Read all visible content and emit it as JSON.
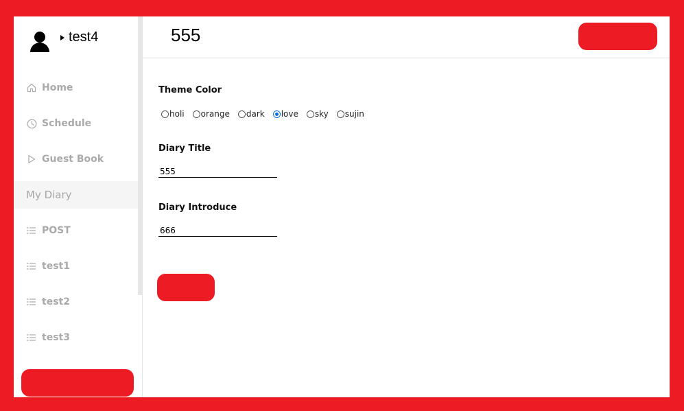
{
  "profile": {
    "username": "test4"
  },
  "sidebar": {
    "items": [
      {
        "label": "Home",
        "icon": "home-icon"
      },
      {
        "label": "Schedule",
        "icon": "clock-icon"
      },
      {
        "label": "Guest Book",
        "icon": "play-icon"
      },
      {
        "label": "My Diary",
        "icon": null
      },
      {
        "label": "POST",
        "icon": "list-icon"
      },
      {
        "label": "test1",
        "icon": "list-icon"
      },
      {
        "label": "test2",
        "icon": "list-icon"
      },
      {
        "label": "test3",
        "icon": "list-icon"
      }
    ]
  },
  "header": {
    "title": "555"
  },
  "form": {
    "theme_label": "Theme Color",
    "themes": [
      "holi",
      "orange",
      "dark",
      "love",
      "sky",
      "sujin"
    ],
    "selected_theme": "love",
    "title_label": "Diary Title",
    "title_value": "555",
    "intro_label": "Diary Introduce",
    "intro_value": "666"
  },
  "colors": {
    "redaction": "#ed1c24",
    "radio_selected": "#0b6fd9",
    "nav_text": "#aaaaaa"
  }
}
